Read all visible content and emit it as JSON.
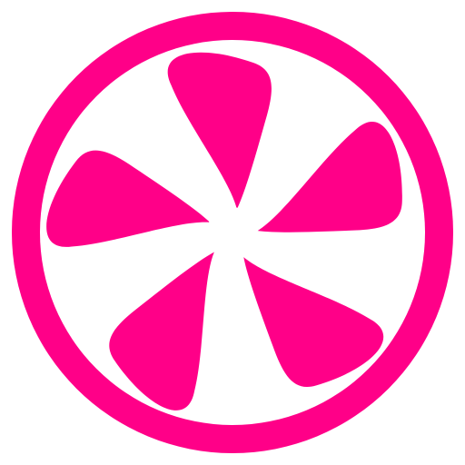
{
  "logo": {
    "icon": "pinwheel-fan-icon",
    "brand_color": "#FF0088",
    "background_color": "#FFFFFF",
    "petal_count": 5
  }
}
